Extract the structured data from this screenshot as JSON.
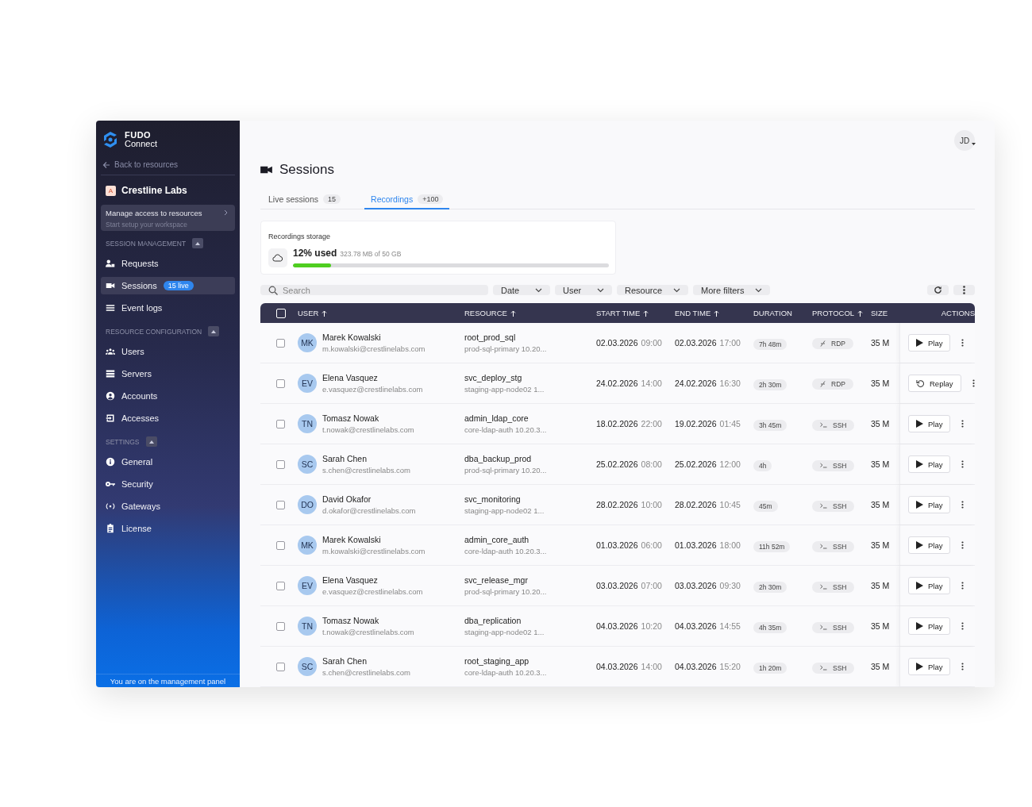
{
  "sidebar": {
    "logo": {
      "line1": "FUDO",
      "line2": "Connect"
    },
    "back_link": "Back to resources",
    "workspace": {
      "badge": "A",
      "name": "Crestline Labs"
    },
    "setup_card": {
      "title": "Manage access to resources",
      "subtitle": "Start setup your workspace"
    },
    "sections": [
      {
        "title": "SESSION MANAGEMENT",
        "expanded": true,
        "items": [
          {
            "label": "Requests",
            "kind": "requests",
            "selected": false
          },
          {
            "label": "Sessions",
            "kind": "sessions",
            "selected": true,
            "badge": "15 live"
          },
          {
            "label": "Event logs",
            "kind": "logs",
            "selected": false
          }
        ]
      },
      {
        "title": "RESOURCE CONFIGURATION",
        "expanded": true,
        "items": [
          {
            "label": "Users",
            "kind": "users",
            "selected": false
          },
          {
            "label": "Servers",
            "kind": "servers",
            "selected": false
          },
          {
            "label": "Accounts",
            "kind": "accounts",
            "selected": false
          },
          {
            "label": "Accesses",
            "kind": "accesses",
            "selected": false
          }
        ]
      },
      {
        "title": "SETTINGS",
        "expanded": true,
        "items": [
          {
            "label": "General",
            "kind": "info",
            "selected": false
          },
          {
            "label": "Security",
            "kind": "key",
            "selected": false
          },
          {
            "label": "Gateways",
            "kind": "gateways",
            "selected": false
          },
          {
            "label": "License",
            "kind": "license",
            "selected": false
          }
        ]
      }
    ],
    "footer": "You are on the management panel"
  },
  "user_menu": {
    "initials": "JD"
  },
  "page_title": "Sessions",
  "tabs": [
    {
      "label": "Live sessions",
      "count": "15",
      "selected": false
    },
    {
      "label": "Recordings",
      "count": "+100",
      "selected": true
    }
  ],
  "storage": {
    "title": "Recordings storage",
    "used": "12% used",
    "detail": "323.78 MB of 50 GB",
    "level": 0.12
  },
  "filters": {
    "search_placeholder": "Search",
    "dropdowns": [
      "Date",
      "User",
      "Resource",
      "More filters"
    ]
  },
  "table": {
    "columns": [
      {
        "label": "USER",
        "sortable": true
      },
      {
        "label": "RESOURCE",
        "sortable": true
      },
      {
        "label": "START TIME",
        "sortable": true
      },
      {
        "label": "END TIME",
        "sortable": true
      },
      {
        "label": "DURATION",
        "sortable": false
      },
      {
        "label": "PROTOCOL",
        "sortable": true
      },
      {
        "label": "SIZE",
        "sortable": false
      },
      {
        "label": "ACTIONS",
        "sortable": false
      }
    ],
    "select_all": false,
    "rows": [
      {
        "checked": false,
        "initials": "MK",
        "name": "Marek Kowalski",
        "email": "m.kowalski@crestlinelabs.com",
        "resource": "root_prod_sql",
        "host": "prod-sql-primary 10.20...",
        "start_date": "02.03.2026",
        "start_time": "09:00",
        "end_date": "02.03.2026",
        "end_time": "17:00",
        "duration": "7h 48m",
        "protocol": {
          "label": "RDP",
          "kind": "remote_desktop"
        },
        "size": "35 M",
        "action": {
          "kind": "play",
          "label": "Play"
        }
      },
      {
        "checked": false,
        "initials": "EV",
        "name": "Elena Vasquez",
        "email": "e.vasquez@crestlinelabs.com",
        "resource": "svc_deploy_stg",
        "host": "staging-app-node02 1...",
        "start_date": "24.02.2026",
        "start_time": "14:00",
        "end_date": "24.02.2026",
        "end_time": "16:30",
        "duration": "2h 30m",
        "protocol": {
          "label": "RDP",
          "kind": "remote_desktop"
        },
        "size": "35 M",
        "action": {
          "kind": "replay",
          "label": "Replay"
        }
      },
      {
        "checked": false,
        "initials": "TN",
        "name": "Tomasz Nowak",
        "email": "t.nowak@crestlinelabs.com",
        "resource": "admin_ldap_core",
        "host": "core-ldap-auth 10.20.3...",
        "start_date": "18.02.2026",
        "start_time": "22:00",
        "end_date": "19.02.2026",
        "end_time": "01:45",
        "duration": "3h 45m",
        "protocol": {
          "label": "SSH",
          "kind": "terminal"
        },
        "size": "35 M",
        "action": {
          "kind": "play",
          "label": "Play"
        }
      },
      {
        "checked": false,
        "initials": "SC",
        "name": "Sarah Chen",
        "email": "s.chen@crestlinelabs.com",
        "resource": "dba_backup_prod",
        "host": "prod-sql-primary 10.20...",
        "start_date": "25.02.2026",
        "start_time": "08:00",
        "end_date": "25.02.2026",
        "end_time": "12:00",
        "duration": "4h",
        "protocol": {
          "label": "SSH",
          "kind": "terminal"
        },
        "size": "35 M",
        "action": {
          "kind": "play",
          "label": "Play"
        }
      },
      {
        "checked": false,
        "initials": "DO",
        "name": "David Okafor",
        "email": "d.okafor@crestlinelabs.com",
        "resource": "svc_monitoring",
        "host": "staging-app-node02 1...",
        "start_date": "28.02.2026",
        "start_time": "10:00",
        "end_date": "28.02.2026",
        "end_time": "10:45",
        "duration": "45m",
        "protocol": {
          "label": "SSH",
          "kind": "terminal"
        },
        "size": "35 M",
        "action": {
          "kind": "play",
          "label": "Play"
        }
      },
      {
        "checked": false,
        "initials": "MK",
        "name": "Marek Kowalski",
        "email": "m.kowalski@crestlinelabs.com",
        "resource": "admin_core_auth",
        "host": "core-ldap-auth 10.20.3...",
        "start_date": "01.03.2026",
        "start_time": "06:00",
        "end_date": "01.03.2026",
        "end_time": "18:00",
        "duration": "11h 52m",
        "protocol": {
          "label": "SSH",
          "kind": "terminal"
        },
        "size": "35 M",
        "action": {
          "kind": "play",
          "label": "Play"
        }
      },
      {
        "checked": false,
        "initials": "EV",
        "name": "Elena Vasquez",
        "email": "e.vasquez@crestlinelabs.com",
        "resource": "svc_release_mgr",
        "host": "prod-sql-primary 10.20...",
        "start_date": "03.03.2026",
        "start_time": "07:00",
        "end_date": "03.03.2026",
        "end_time": "09:30",
        "duration": "2h 30m",
        "protocol": {
          "label": "SSH",
          "kind": "terminal"
        },
        "size": "35 M",
        "action": {
          "kind": "play",
          "label": "Play"
        }
      },
      {
        "checked": false,
        "initials": "TN",
        "name": "Tomasz Nowak",
        "email": "t.nowak@crestlinelabs.com",
        "resource": "dba_replication",
        "host": "staging-app-node02 1...",
        "start_date": "04.03.2026",
        "start_time": "10:20",
        "end_date": "04.03.2026",
        "end_time": "14:55",
        "duration": "4h 35m",
        "protocol": {
          "label": "SSH",
          "kind": "terminal"
        },
        "size": "35 M",
        "action": {
          "kind": "play",
          "label": "Play"
        }
      },
      {
        "checked": false,
        "initials": "SC",
        "name": "Sarah Chen",
        "email": "s.chen@crestlinelabs.com",
        "resource": "root_staging_app",
        "host": "core-ldap-auth 10.20.3...",
        "start_date": "04.03.2026",
        "start_time": "14:00",
        "end_date": "04.03.2026",
        "end_time": "15:20",
        "duration": "1h 20m",
        "protocol": {
          "label": "SSH",
          "kind": "terminal"
        },
        "size": "35 M",
        "action": {
          "kind": "play",
          "label": "Play"
        }
      }
    ]
  }
}
